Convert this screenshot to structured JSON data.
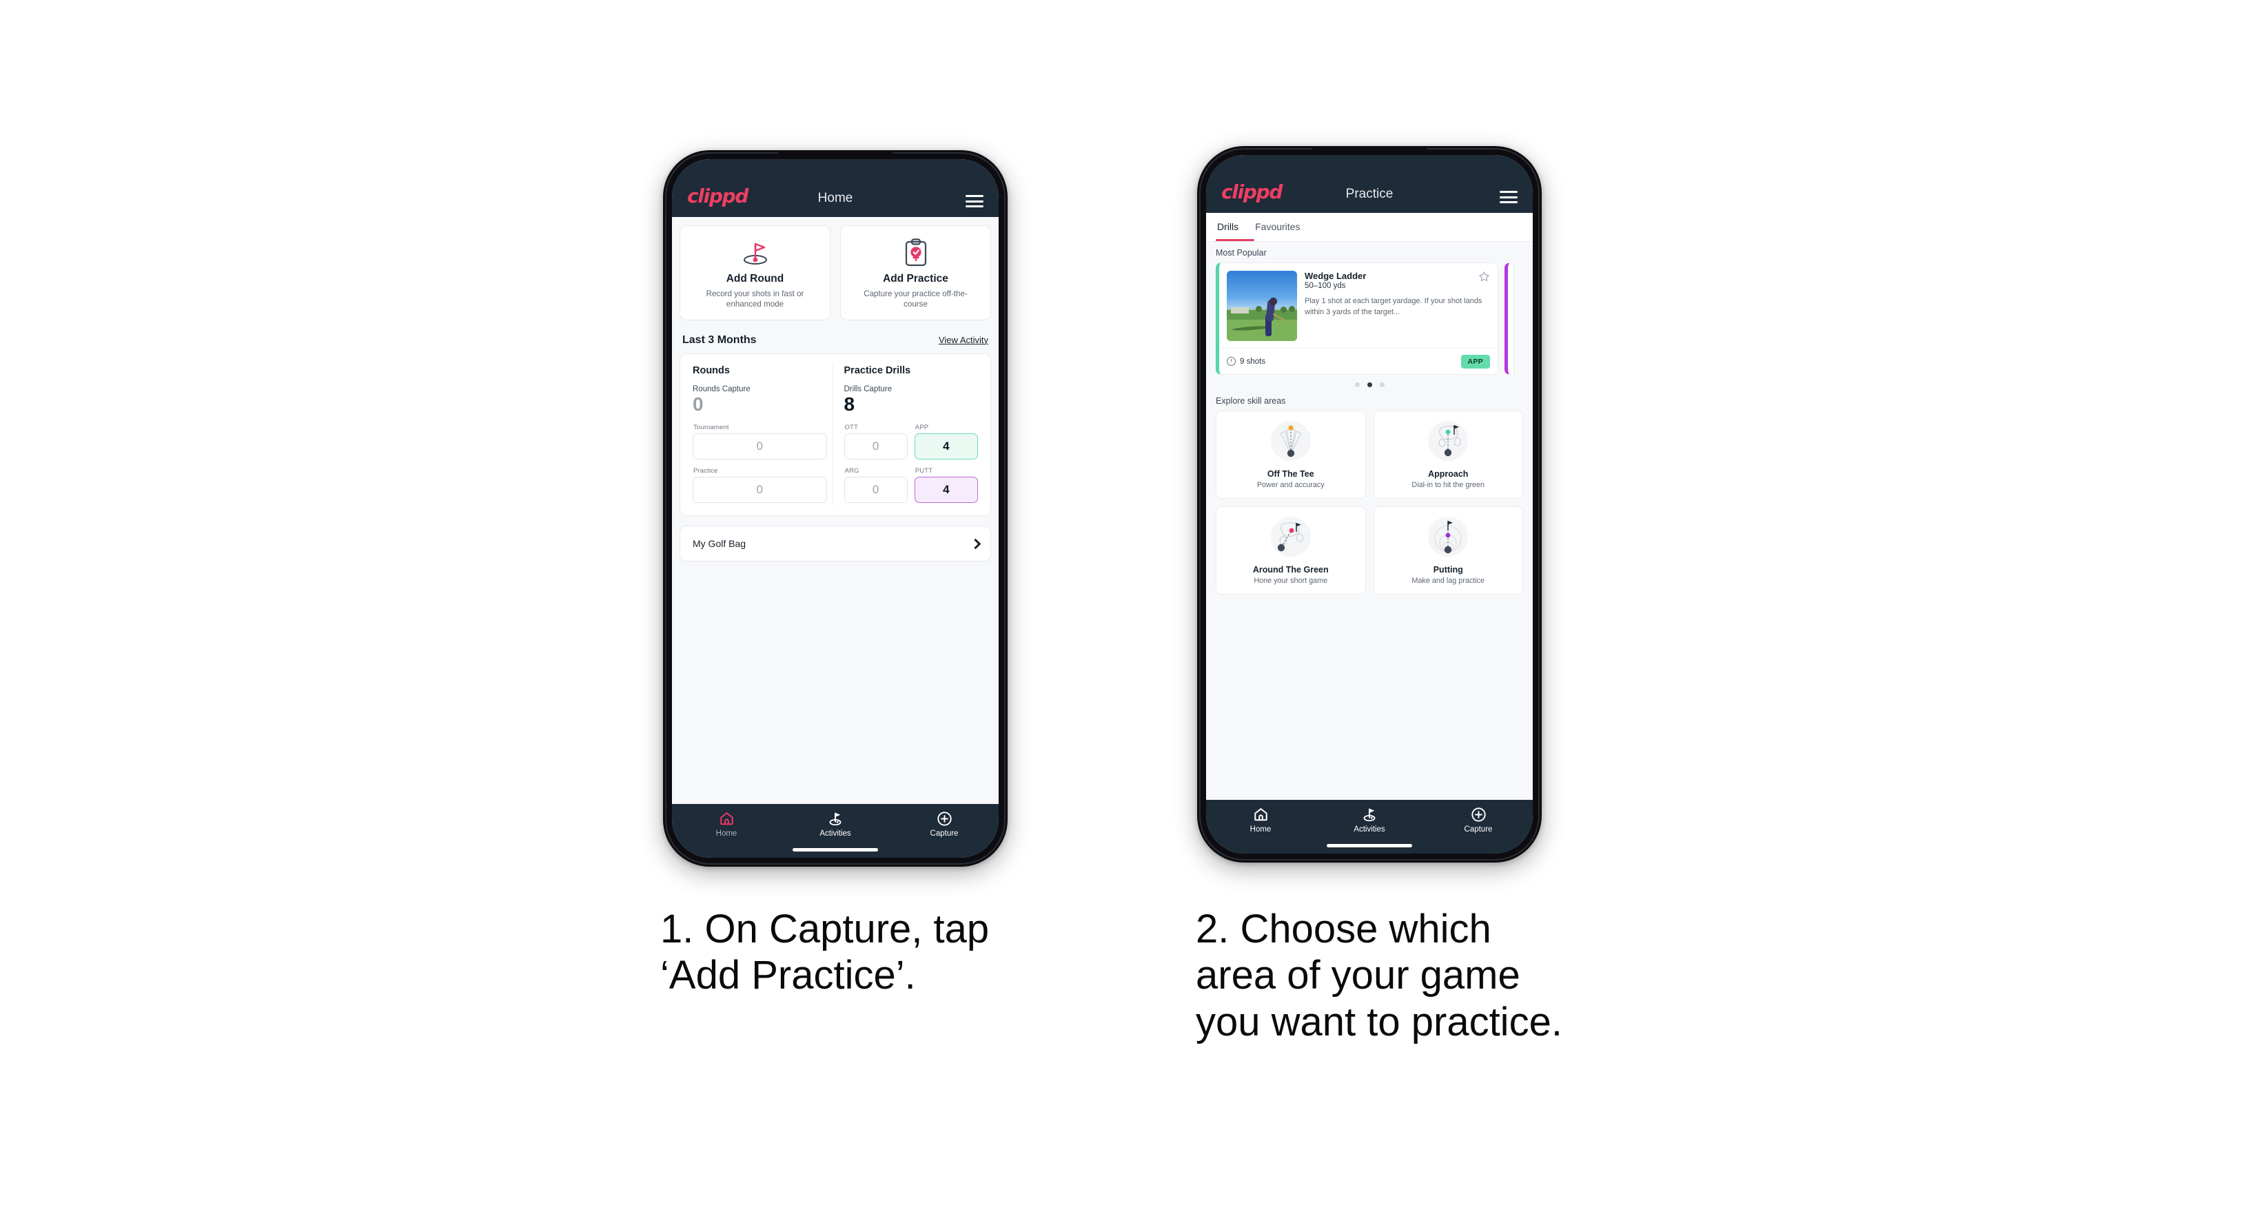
{
  "brand": "clippd",
  "phone1": {
    "appbar": {
      "title": "Home",
      "menu_icon": "hamburger-icon"
    },
    "actions": [
      {
        "icon": "golf-flag-hole-icon",
        "title": "Add Round",
        "sub": "Record your shots in fast or enhanced mode"
      },
      {
        "icon": "clipboard-check-icon",
        "title": "Add Practice",
        "sub": "Capture your practice off-the-course"
      }
    ],
    "section": {
      "title": "Last 3 Months",
      "link": "View Activity"
    },
    "rounds": {
      "heading": "Rounds",
      "capture_label": "Rounds Capture",
      "capture_value": "0",
      "fields": [
        {
          "label": "Tournament",
          "value": "0",
          "state": "empty"
        },
        {
          "label": "Practice",
          "value": "0",
          "state": "empty"
        }
      ]
    },
    "drills": {
      "heading": "Practice Drills",
      "capture_label": "Drills Capture",
      "capture_value": "8",
      "fields": [
        {
          "label": "OTT",
          "value": "0",
          "state": "empty"
        },
        {
          "label": "APP",
          "value": "4",
          "state": "green"
        },
        {
          "label": "ARG",
          "value": "0",
          "state": "empty"
        },
        {
          "label": "PUTT",
          "value": "4",
          "state": "purple"
        }
      ]
    },
    "golf_bag": {
      "label": "My Golf Bag",
      "chevron_icon": "chevron-right-icon"
    },
    "bottom_nav": [
      {
        "label": "Home",
        "icon": "home-icon",
        "active": true
      },
      {
        "label": "Activities",
        "icon": "golf-flag-icon",
        "active": false
      },
      {
        "label": "Capture",
        "icon": "plus-circle-icon",
        "active": false
      }
    ]
  },
  "phone2": {
    "appbar": {
      "title": "Practice",
      "menu_icon": "hamburger-icon"
    },
    "tabs": [
      {
        "label": "Drills",
        "active": true
      },
      {
        "label": "Favourites",
        "active": false
      }
    ],
    "most_popular_label": "Most Popular",
    "drill": {
      "title": "Wedge Ladder",
      "yardage": "50–100 yds",
      "description": "Play 1 shot at each target yardage. If your shot lands within 3 yards of the target...",
      "shots": "9 shots",
      "tag": "APP",
      "star_icon": "star-outline-icon",
      "shots_icon": "clock-icon",
      "accent_color": "#56d6a7",
      "tag_color": "#64dcac",
      "next_card_accent": "#b437e0"
    },
    "carousel_dots": {
      "count": 3,
      "active_index": 1
    },
    "skill_section_label": "Explore skill areas",
    "skills": [
      {
        "name": "Off The Tee",
        "sub": "Power and accuracy",
        "icon": "tee-shot-fan-icon",
        "dot_color": "#f5a623"
      },
      {
        "name": "Approach",
        "sub": "Dial-in to hit the green",
        "icon": "approach-green-icon",
        "dot_color": "#3fd1ae"
      },
      {
        "name": "Around The Green",
        "sub": "Hone your short game",
        "icon": "chip-green-icon",
        "dot_color": "#e8386a"
      },
      {
        "name": "Putting",
        "sub": "Make and lag practice",
        "icon": "putting-rings-icon",
        "dot_color": "#9b2fd6"
      }
    ],
    "bottom_nav": [
      {
        "label": "Home",
        "icon": "home-icon",
        "active": false
      },
      {
        "label": "Activities",
        "icon": "golf-flag-icon",
        "active": false
      },
      {
        "label": "Capture",
        "icon": "plus-circle-icon",
        "active": false
      }
    ]
  },
  "captions": {
    "one": "1. On Capture, tap\n‘Add Practice’.",
    "two": "2. Choose which\narea of your game\nyou want to practice."
  },
  "colors": {
    "brand_pink": "#ef3e62",
    "app_bar": "#1e2b38",
    "accent_green": "#64dcac",
    "accent_purple": "#b437e0"
  }
}
